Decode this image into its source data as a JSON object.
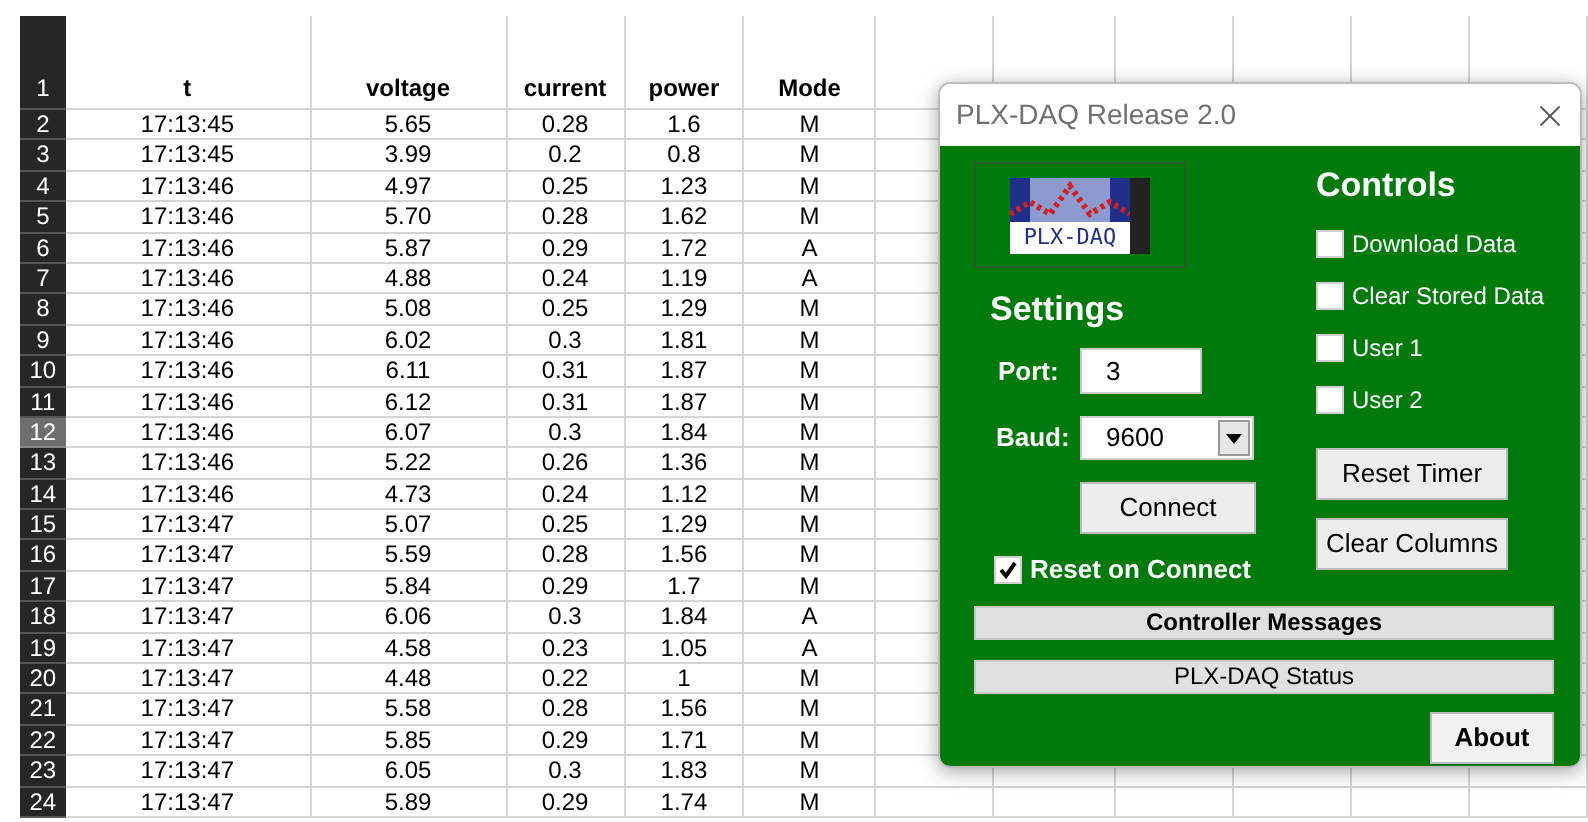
{
  "sheet": {
    "header": {
      "row_number": "1",
      "cells": [
        "t",
        "voltage",
        "current",
        "power",
        "Mode"
      ]
    },
    "rows": [
      {
        "row_number": "2",
        "selected": false,
        "cells": [
          "17:13:45",
          "5.65",
          "0.28",
          "1.6",
          "M"
        ]
      },
      {
        "row_number": "3",
        "selected": false,
        "cells": [
          "17:13:45",
          "3.99",
          "0.2",
          "0.8",
          "M"
        ]
      },
      {
        "row_number": "4",
        "selected": false,
        "cells": [
          "17:13:46",
          "4.97",
          "0.25",
          "1.23",
          "M"
        ]
      },
      {
        "row_number": "5",
        "selected": false,
        "cells": [
          "17:13:46",
          "5.70",
          "0.28",
          "1.62",
          "M"
        ]
      },
      {
        "row_number": "6",
        "selected": false,
        "cells": [
          "17:13:46",
          "5.87",
          "0.29",
          "1.72",
          "A"
        ]
      },
      {
        "row_number": "7",
        "selected": false,
        "cells": [
          "17:13:46",
          "4.88",
          "0.24",
          "1.19",
          "A"
        ]
      },
      {
        "row_number": "8",
        "selected": false,
        "cells": [
          "17:13:46",
          "5.08",
          "0.25",
          "1.29",
          "M"
        ]
      },
      {
        "row_number": "9",
        "selected": false,
        "cells": [
          "17:13:46",
          "6.02",
          "0.3",
          "1.81",
          "M"
        ]
      },
      {
        "row_number": "10",
        "selected": false,
        "cells": [
          "17:13:46",
          "6.11",
          "0.31",
          "1.87",
          "M"
        ]
      },
      {
        "row_number": "11",
        "selected": false,
        "cells": [
          "17:13:46",
          "6.12",
          "0.31",
          "1.87",
          "M"
        ]
      },
      {
        "row_number": "12",
        "selected": true,
        "cells": [
          "17:13:46",
          "6.07",
          "0.3",
          "1.84",
          "M"
        ]
      },
      {
        "row_number": "13",
        "selected": false,
        "cells": [
          "17:13:46",
          "5.22",
          "0.26",
          "1.36",
          "M"
        ]
      },
      {
        "row_number": "14",
        "selected": false,
        "cells": [
          "17:13:46",
          "4.73",
          "0.24",
          "1.12",
          "M"
        ]
      },
      {
        "row_number": "15",
        "selected": false,
        "cells": [
          "17:13:47",
          "5.07",
          "0.25",
          "1.29",
          "M"
        ]
      },
      {
        "row_number": "16",
        "selected": false,
        "cells": [
          "17:13:47",
          "5.59",
          "0.28",
          "1.56",
          "M"
        ]
      },
      {
        "row_number": "17",
        "selected": false,
        "cells": [
          "17:13:47",
          "5.84",
          "0.29",
          "1.7",
          "M"
        ]
      },
      {
        "row_number": "18",
        "selected": false,
        "cells": [
          "17:13:47",
          "6.06",
          "0.3",
          "1.84",
          "A"
        ]
      },
      {
        "row_number": "19",
        "selected": false,
        "cells": [
          "17:13:47",
          "4.58",
          "0.23",
          "1.05",
          "A"
        ]
      },
      {
        "row_number": "20",
        "selected": false,
        "cells": [
          "17:13:47",
          "4.48",
          "0.22",
          "1",
          "M"
        ]
      },
      {
        "row_number": "21",
        "selected": false,
        "cells": [
          "17:13:47",
          "5.58",
          "0.28",
          "1.56",
          "M"
        ]
      },
      {
        "row_number": "22",
        "selected": false,
        "cells": [
          "17:13:47",
          "5.85",
          "0.29",
          "1.71",
          "M"
        ]
      },
      {
        "row_number": "23",
        "selected": false,
        "cells": [
          "17:13:47",
          "6.05",
          "0.3",
          "1.83",
          "M"
        ]
      },
      {
        "row_number": "24",
        "selected": false,
        "cells": [
          "17:13:47",
          "5.89",
          "0.29",
          "1.74",
          "M"
        ]
      }
    ]
  },
  "dialog": {
    "title": "PLX-DAQ Release 2.0",
    "logo_text": "PLX-DAQ",
    "settings": {
      "heading": "Settings",
      "port": {
        "label": "Port:",
        "value": "3"
      },
      "baud": {
        "label": "Baud:",
        "value": "9600"
      },
      "connect_button": "Connect",
      "reset_on_connect": {
        "label": "Reset on Connect",
        "checked": true
      }
    },
    "controls": {
      "heading": "Controls",
      "checkboxes": [
        {
          "label": "Download Data",
          "checked": false
        },
        {
          "label": "Clear Stored Data",
          "checked": false
        },
        {
          "label": "User 1",
          "checked": false
        },
        {
          "label": "User 2",
          "checked": false
        }
      ],
      "buttons": [
        "Reset Timer",
        "Clear Columns"
      ]
    },
    "controller_messages": "Controller Messages",
    "status": "PLX-DAQ Status",
    "about_button": "About"
  }
}
